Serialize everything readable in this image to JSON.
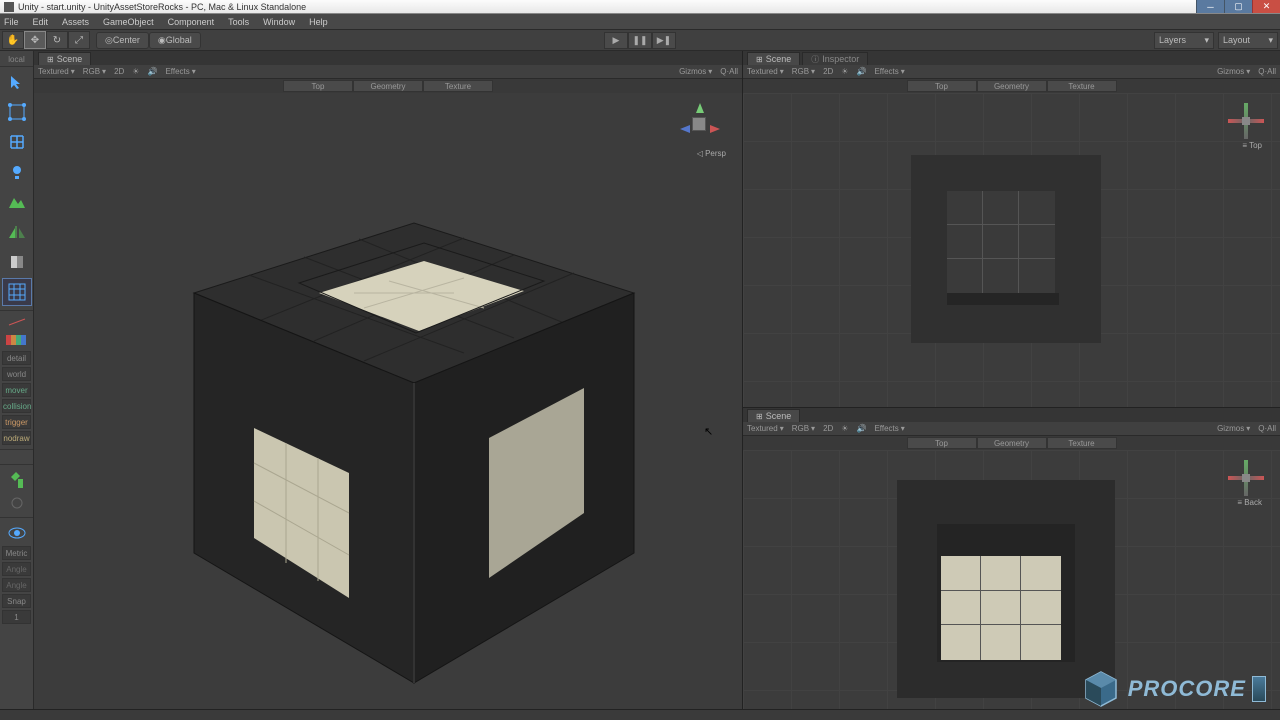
{
  "window": {
    "title": "Unity - start.unity - UnityAssetStoreRocks - PC, Mac & Linux Standalone"
  },
  "menu": {
    "file": "File",
    "edit": "Edit",
    "assets": "Assets",
    "gameobject": "GameObject",
    "component": "Component",
    "tools": "Tools",
    "window": "Window",
    "help": "Help"
  },
  "toolbar": {
    "center": "Center",
    "global": "Global",
    "layers": "Layers",
    "layout": "Layout"
  },
  "sidebar": {
    "head": "local",
    "labels": {
      "detail": "detail",
      "world": "world",
      "mover": "mover",
      "collision": "collision",
      "trigger": "trigger",
      "nodraw": "nodraw"
    },
    "bottom": {
      "metric": "Metric",
      "angle": "Angle",
      "snap": "Snap",
      "one": "1"
    }
  },
  "tabs": {
    "scene": "Scene",
    "inspector": "Inspector"
  },
  "viewbar": {
    "textured": "Textured",
    "rgb": "RGB",
    "twod": "2D",
    "effects": "Effects",
    "gizmos": "Gizmos",
    "qall": "Q·All"
  },
  "subtabs": {
    "top": "Top",
    "geometry": "Geometry",
    "texture": "Texture"
  },
  "gizmo": {
    "persp": "Persp",
    "top": "Top",
    "back": "Back"
  },
  "logo": {
    "text": "PROCORE"
  }
}
